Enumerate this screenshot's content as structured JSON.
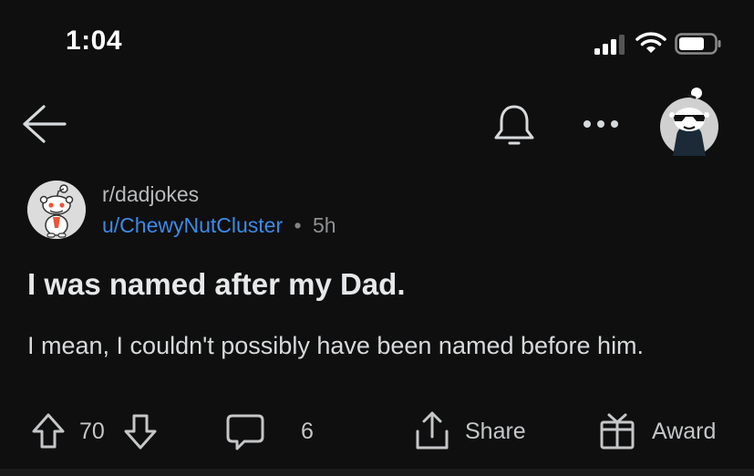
{
  "status_bar": {
    "time": "1:04",
    "icons": [
      "cellular-signal-icon",
      "wifi-icon",
      "battery-icon"
    ]
  },
  "nav": {
    "icons": [
      "back-arrow-icon",
      "bell-icon",
      "more-options-icon",
      "user-avatar"
    ]
  },
  "post": {
    "subreddit": "r/dadjokes",
    "username": "u/ChewyNutCluster",
    "separator": "•",
    "age": "5h",
    "title": "I was named after my Dad.",
    "body": "I mean, I couldn't possibly have been named before him.",
    "votes": "70",
    "comments": "6",
    "share_label": "Share",
    "award_label": "Award"
  },
  "colors": {
    "background": "#0f0f0f",
    "username": "#3d8ae6",
    "text": "#d7dadc",
    "muted": "#8e9092"
  }
}
